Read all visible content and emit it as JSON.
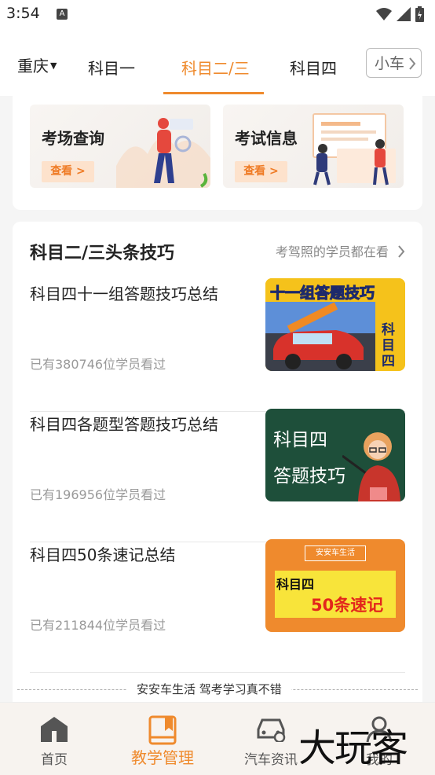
{
  "status_bar": {
    "time": "3:54",
    "a_icon": "A"
  },
  "header": {
    "city": "重庆",
    "tabs": [
      {
        "label": "科目一",
        "active": false
      },
      {
        "label": "科目二/三",
        "active": true
      },
      {
        "label": "科目四",
        "active": false
      }
    ],
    "more_tab": "小车"
  },
  "quick_cards": [
    {
      "title": "考场查询",
      "button": "查看 >"
    },
    {
      "title": "考试信息",
      "button": "查看 >"
    }
  ],
  "section": {
    "title": "科目二/三头条技巧",
    "more": "考驾照的学员都在看"
  },
  "articles": [
    {
      "title": "科目四十一组答题技巧总结",
      "meta": "已有380746位学员看过",
      "thumb_line1": "十一组答题技巧",
      "thumb_line2": "科目四"
    },
    {
      "title": "科目四各题型答题技巧总结",
      "meta": "已有196956位学员看过",
      "thumb_line1": "科目四",
      "thumb_line2": "答题技巧"
    },
    {
      "title": "科目四50条速记总结",
      "meta": "已有211844位学员看过",
      "thumb_brand": "安安车生活",
      "thumb_line1": "科目四",
      "thumb_line2": "50条速记"
    }
  ],
  "footer_text": "安安车生活 驾考学习真不错",
  "nav": [
    {
      "label": "首页",
      "icon": "home-icon",
      "active": false
    },
    {
      "label": "教学管理",
      "icon": "book-icon",
      "active": true
    },
    {
      "label": "汽车资讯",
      "icon": "car-icon",
      "active": false
    },
    {
      "label": "我的",
      "icon": "profile-icon",
      "active": false
    }
  ],
  "watermark": "大玩客",
  "colors": {
    "accent": "#ef8a2d",
    "thumb_green": "#1e4f3a",
    "thumb_orange": "#ef8a2d"
  }
}
